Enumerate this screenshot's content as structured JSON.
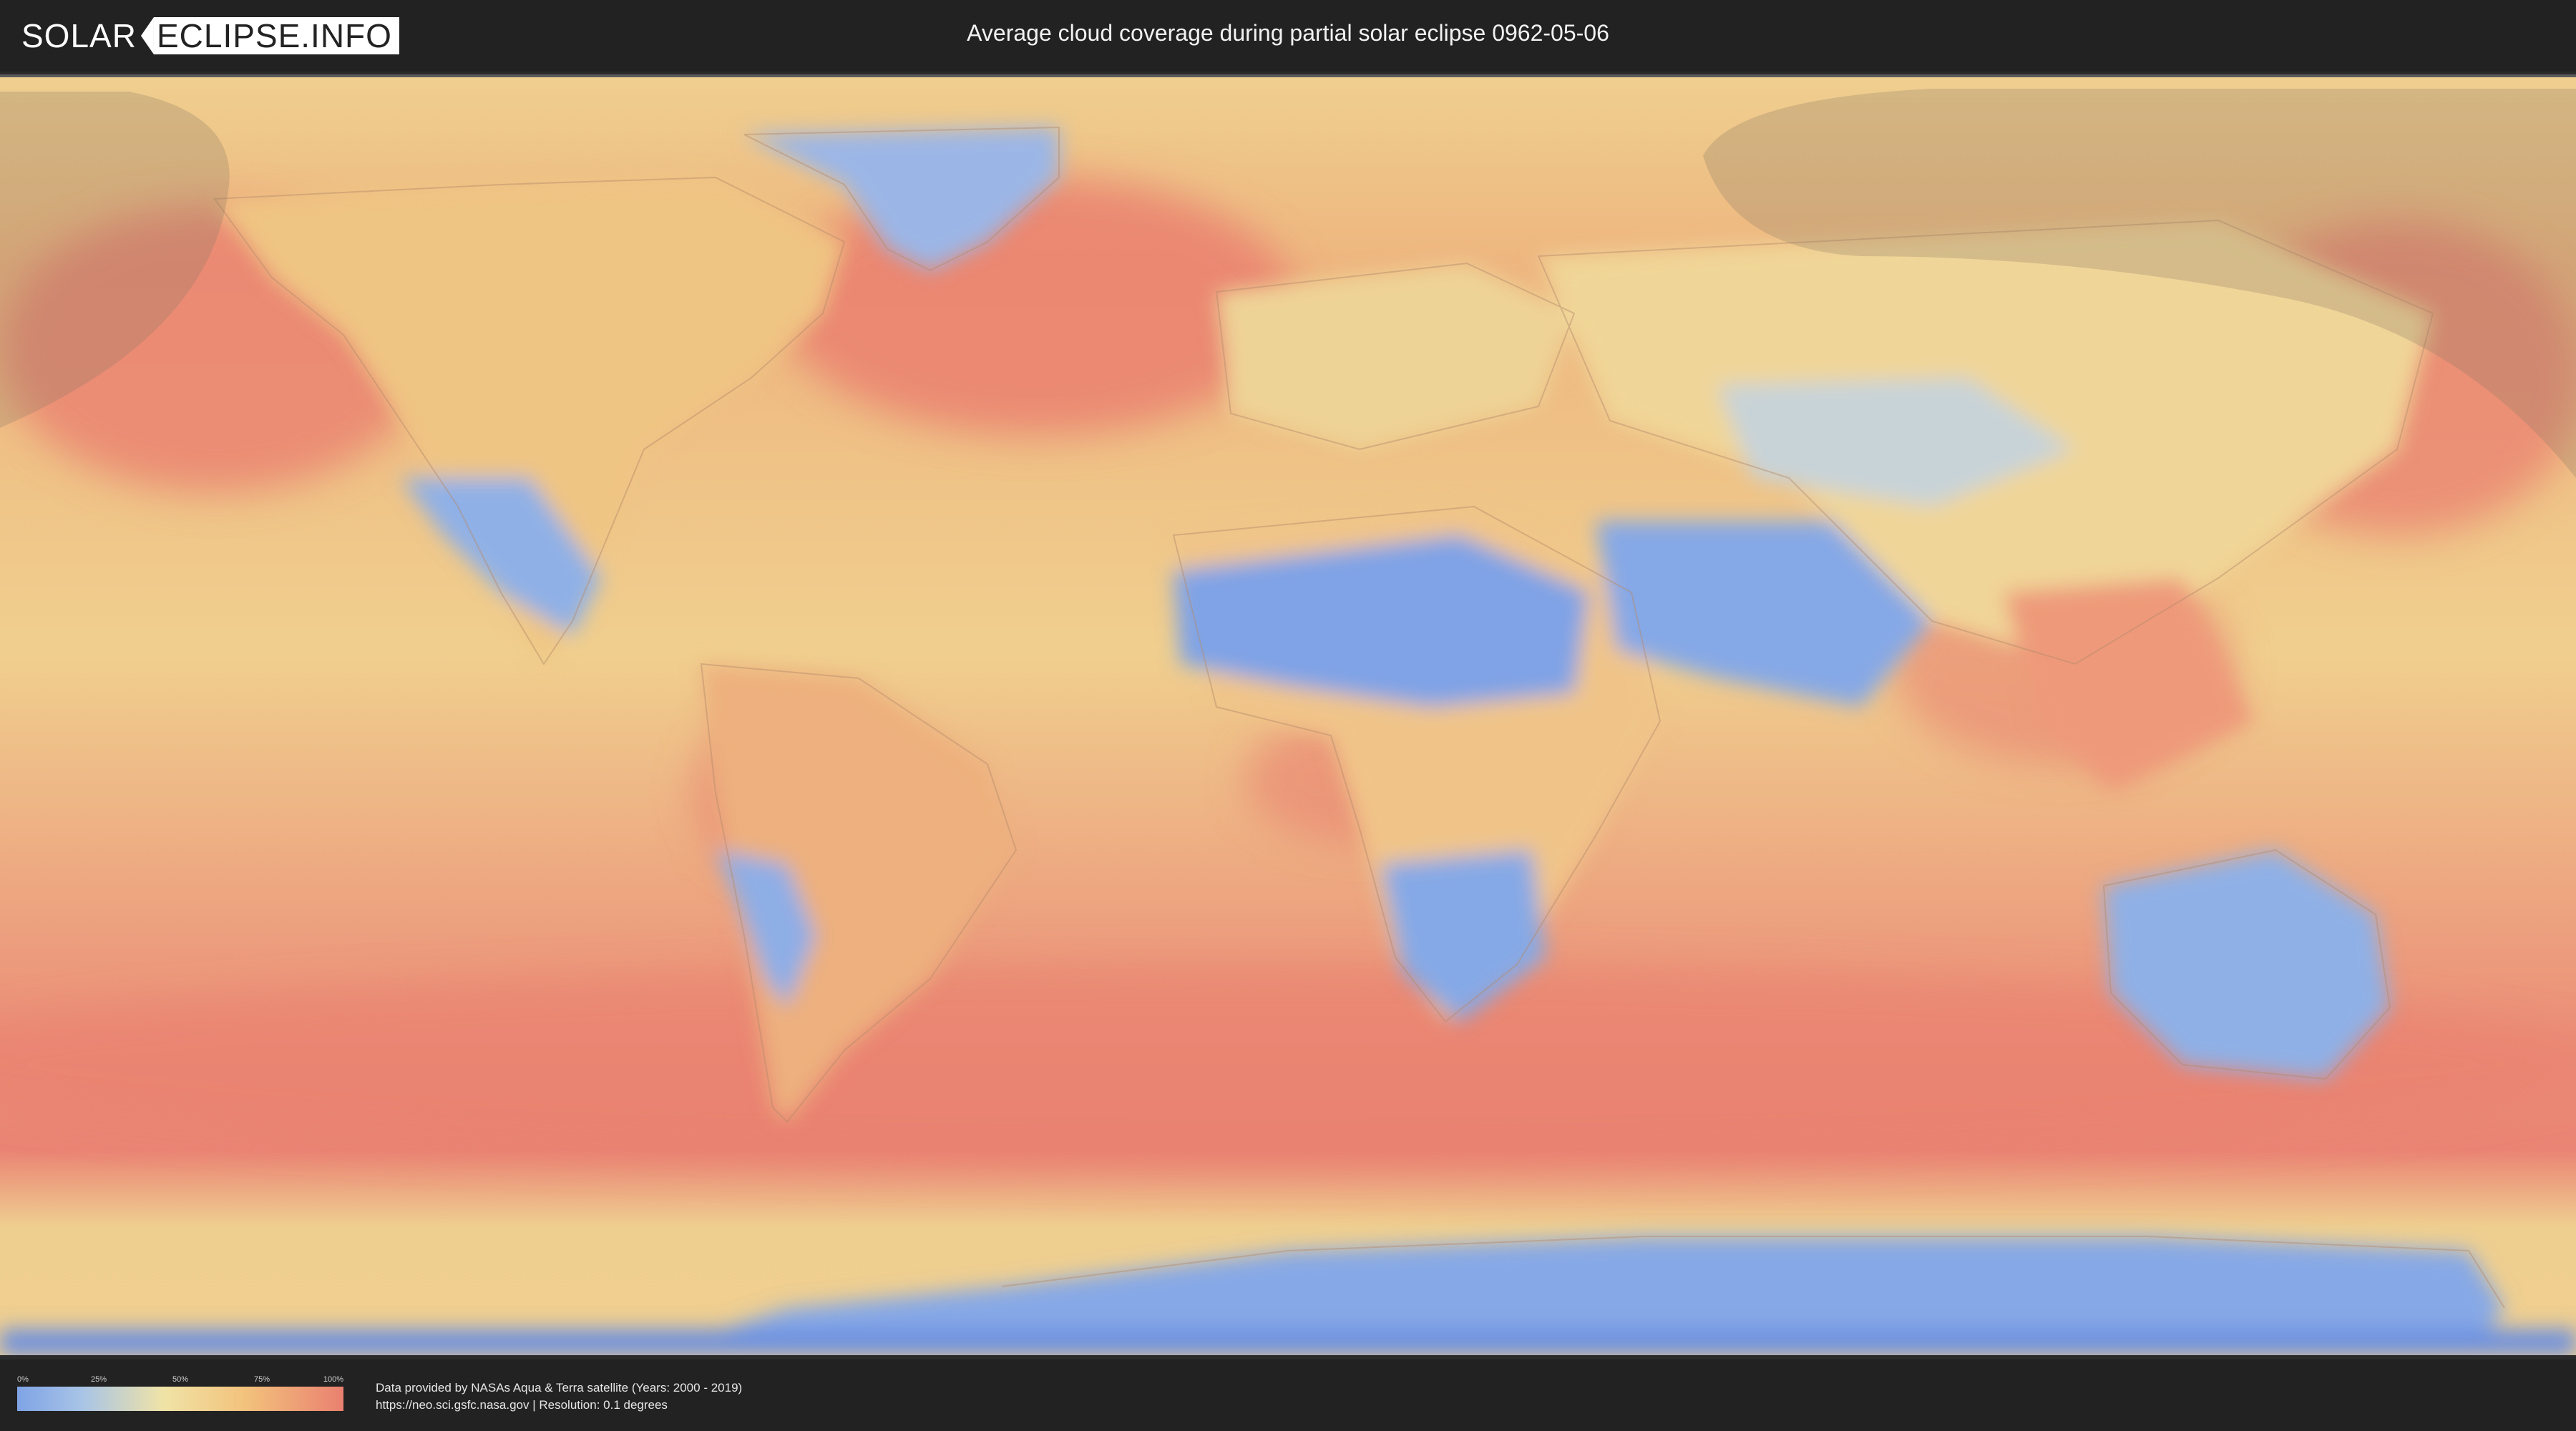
{
  "header": {
    "logo_solar": "SOLAR",
    "logo_eclipse": "ECLIPSE.INFO",
    "title": "Average cloud coverage during partial solar eclipse 0962-05-06"
  },
  "map": {
    "colors": {
      "clear": "#7fa3e6",
      "low": "#a8c4e6",
      "mid": "#f0d896",
      "high": "#f2b77a",
      "overcast": "#ea8070",
      "eclipse_shadow": "#8c7a66"
    }
  },
  "legend": {
    "ticks": [
      "0%",
      "25%",
      "50%",
      "75%",
      "100%"
    ],
    "tick_fractions": [
      0,
      0.25,
      0.5,
      0.75,
      1
    ]
  },
  "footer": {
    "credit_line": "Data provided by NASAs Aqua & Terra satellite (Years: 2000 - 2019)",
    "source_line": "https://neo.sci.gsfc.nasa.gov | Resolution: 0.1 degrees"
  }
}
